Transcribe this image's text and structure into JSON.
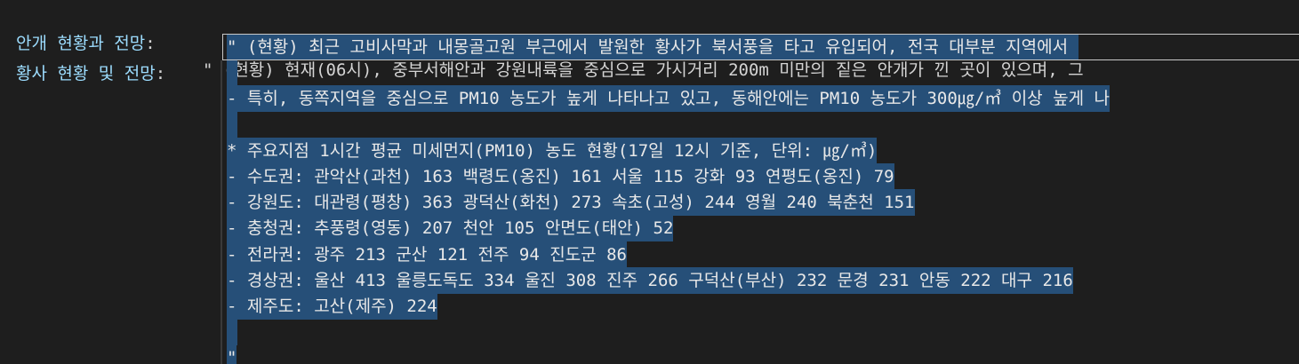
{
  "row1": {
    "key": "안개 현황과 전망",
    "sep": ": ",
    "value": "\" (현황) 현재(06시), 중부서해안과 강원내륙을 중심으로 가시거리 200m 미만의 짙은 안개가 낀 곳이 있으며, 그"
  },
  "row2": {
    "key": "황사 현황 및 전망",
    "sep": ": ",
    "lines": [
      "\" (현황) 최근 고비사막과 내몽골고원 부근에서 발원한 황사가 북서풍을 타고 유입되어, 전국 대부분 지역에서 ",
      "",
      "- 특히, 동쪽지역을 중심으로 PM10 농도가 높게 나타나고 있고, 동해안에는 PM10 농도가 300㎍/㎥ 이상 높게 나",
      "",
      "* 주요지점 1시간 평균 미세먼지(PM10) 농도 현황(17일 12시 기준, 단위: ㎍/㎥)",
      "- 수도권: 관악산(과천) 163 백령도(옹진) 161 서울 115 강화 93 연평도(옹진) 79",
      "- 강원도: 대관령(평창) 363 광덕산(화천) 273 속초(고성) 244 영월 240 북춘천 151",
      "- 충청권: 추풍령(영동) 207 천안 105 안면도(태안) 52",
      "- 전라권: 광주 213 군산 121 전주 94 진도군 86",
      "- 경상권: 울산 413 울릉도독도 334 울진 308 진주 266 구덕산(부산) 232 문경 231 안동 222 대구 216",
      "- 제주도: 고산(제주) 224",
      "",
      "\""
    ]
  }
}
